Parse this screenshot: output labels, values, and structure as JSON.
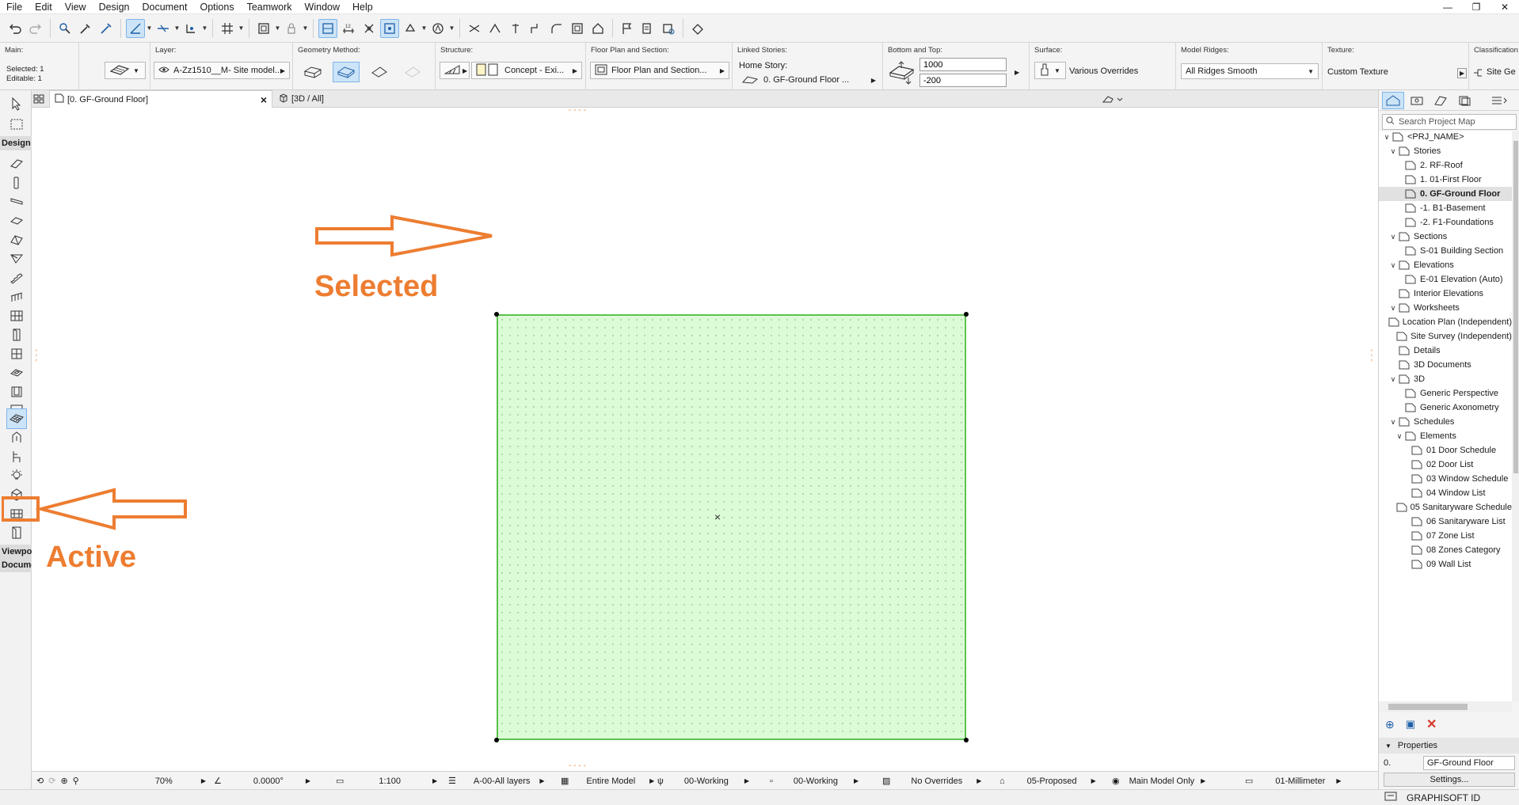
{
  "menubar": {
    "items": [
      "File",
      "Edit",
      "View",
      "Design",
      "Document",
      "Options",
      "Teamwork",
      "Window",
      "Help"
    ]
  },
  "infobox": {
    "main": {
      "label": "Main:",
      "selected": "Selected: 1",
      "editable": "Editable: 1"
    },
    "layer": {
      "label": "Layer:",
      "value": "A-Zz1510__M- Site model..."
    },
    "geometry": {
      "label": "Geometry Method:"
    },
    "structure": {
      "label": "Structure:",
      "value": "Concept - Exi..."
    },
    "floorplan": {
      "label": "Floor Plan and Section:",
      "value": "Floor Plan and Section..."
    },
    "linked": {
      "label": "Linked Stories:",
      "home_story_label": "Home Story:",
      "home_story_value": "0. GF-Ground Floor ..."
    },
    "bottomtop": {
      "label": "Bottom and Top:",
      "top": "1000",
      "bottom": "-200"
    },
    "surface": {
      "label": "Surface:",
      "value": "Various Overrides"
    },
    "ridges": {
      "label": "Model Ridges:",
      "value": "All Ridges Smooth"
    },
    "texture": {
      "label": "Texture:",
      "value": "Custom Texture"
    },
    "classification": {
      "label": "Classification:",
      "value": "Site Ge"
    }
  },
  "tabs": {
    "floor": "[0. GF-Ground Floor]",
    "close": "×",
    "view3d": "[3D / All]"
  },
  "toolbox": {
    "design_header": "Design",
    "viewpoint_header": "Viewpoi",
    "document_header": "Docume"
  },
  "annotations": {
    "selected": "Selected",
    "active": "Active",
    "color": "#ed7d31"
  },
  "statusbar": {
    "zoom": "70%",
    "angle": "0.0000°",
    "scale": "1:100",
    "layers": "A-00-All layers",
    "model": "Entire Model",
    "pen1": "00-Working",
    "pen2": "00-Working",
    "overrides": "No Overrides",
    "renovation": "05-Proposed",
    "structure": "Main Model Only",
    "dimension": "01-Millimeter"
  },
  "navigator": {
    "search_placeholder": "Search Project Map",
    "tree": [
      {
        "label": "<PRJ_NAME>",
        "icon": "project-icon"
      },
      {
        "label": "Stories",
        "icon": "stories-icon"
      },
      {
        "label": "2. RF-Roof",
        "icon": "story-icon"
      },
      {
        "label": "1. 01-First Floor",
        "icon": "story-icon"
      },
      {
        "label": "0. GF-Ground Floor",
        "icon": "story-icon"
      },
      {
        "label": "-1. B1-Basement",
        "icon": "story-icon"
      },
      {
        "label": "-2. F1-Foundations",
        "icon": "story-icon"
      },
      {
        "label": "Sections",
        "icon": "sections-icon"
      },
      {
        "label": "S-01 Building Section",
        "icon": "section-icon"
      },
      {
        "label": "Elevations",
        "icon": "elevations-icon"
      },
      {
        "label": "E-01 Elevation (Auto)",
        "icon": "elevation-icon"
      },
      {
        "label": "Interior Elevations",
        "icon": "interior-elevation-icon"
      },
      {
        "label": "Worksheets",
        "icon": "worksheets-icon"
      },
      {
        "label": "Location Plan (Independent)",
        "icon": "worksheet-icon"
      },
      {
        "label": "Site Survey (Independent)",
        "icon": "worksheet-icon"
      },
      {
        "label": "Details",
        "icon": "details-icon"
      },
      {
        "label": "3D Documents",
        "icon": "3d-documents-icon"
      },
      {
        "label": "3D",
        "icon": "3d-icon"
      },
      {
        "label": "Generic Perspective",
        "icon": "perspective-icon"
      },
      {
        "label": "Generic Axonometry",
        "icon": "axonometry-icon"
      },
      {
        "label": "Schedules",
        "icon": "schedules-icon"
      },
      {
        "label": "Elements",
        "icon": "elements-icon"
      },
      {
        "label": "01 Door Schedule",
        "icon": "schedule-icon"
      },
      {
        "label": "02 Door List",
        "icon": "schedule-icon"
      },
      {
        "label": "03 Window Schedule",
        "icon": "schedule-icon"
      },
      {
        "label": "04 Window List",
        "icon": "schedule-icon"
      },
      {
        "label": "05 Sanitaryware Schedule",
        "icon": "schedule-icon"
      },
      {
        "label": "06 Sanitaryware List",
        "icon": "schedule-icon"
      },
      {
        "label": "07 Zone List",
        "icon": "schedule-icon"
      },
      {
        "label": "08 Zones Category",
        "icon": "schedule-icon"
      },
      {
        "label": "09 Wall List",
        "icon": "schedule-icon"
      }
    ],
    "properties_header": "Properties",
    "props_id": "0.",
    "props_value": "GF-Ground Floor",
    "settings_label": "Settings...",
    "brand": "GRAPHISOFT ID"
  }
}
